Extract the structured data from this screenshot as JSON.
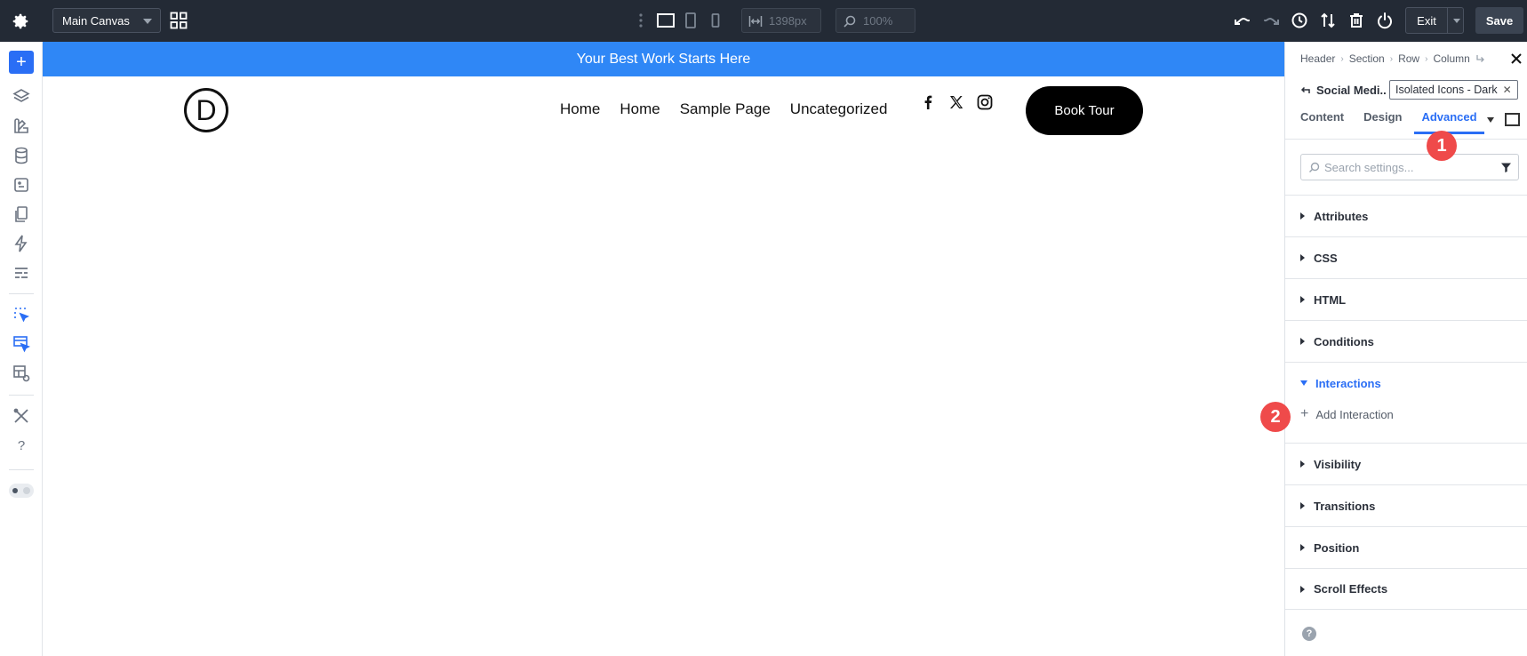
{
  "topbar": {
    "canvas_select": "Main Canvas",
    "width_value": "1398px",
    "zoom_value": "100%",
    "exit_label": "Exit",
    "save_label": "Save"
  },
  "banner": {
    "text": "Your Best Work Starts Here"
  },
  "header": {
    "logo_letter": "D",
    "nav": [
      "Home",
      "Home",
      "Sample Page",
      "Uncategorized"
    ],
    "social": [
      "facebook-icon",
      "x-icon",
      "instagram-icon"
    ],
    "cta_label": "Book Tour"
  },
  "panel": {
    "breadcrumbs": [
      "Header",
      "Section",
      "Row",
      "Column"
    ],
    "module_name": "Social Medi...",
    "preset": "Isolated Icons - Dark",
    "tabs": [
      "Content",
      "Design",
      "Advanced"
    ],
    "active_tab": "Advanced",
    "search_placeholder": "Search settings...",
    "sections": [
      "Attributes",
      "CSS",
      "HTML",
      "Conditions",
      "Interactions",
      "Visibility",
      "Transitions",
      "Position",
      "Scroll Effects"
    ],
    "expanded_section": "Interactions",
    "add_interaction": "Add Interaction",
    "help": "?"
  },
  "annotations": [
    "1",
    "2"
  ],
  "colors": {
    "accent": "#2a6ef5",
    "banner": "#2f87f6",
    "topbar": "#232a35",
    "badge": "#ef4a4a"
  }
}
